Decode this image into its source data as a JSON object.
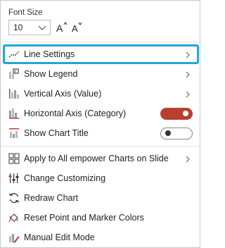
{
  "font_size": {
    "label": "Font Size",
    "value": "10",
    "increase_label": "A",
    "decrease_label": "A"
  },
  "menu": {
    "line_settings": "Line Settings",
    "show_legend": "Show Legend",
    "vertical_axis": "Vertical Axis (Value)",
    "horizontal_axis": "Horizontal Axis (Category)",
    "show_chart_title": "Show Chart Title",
    "apply_all": "Apply to All empower Charts on Slide",
    "change_customizing": "Change Customizing",
    "redraw_chart": "Redraw Chart",
    "reset_colors": "Reset Point and Marker Colors",
    "manual_edit": "Manual Edit Mode"
  },
  "toggles": {
    "horizontal_axis_on": true,
    "show_chart_title_on": false
  },
  "colors": {
    "highlight_border": "#1fa7d6",
    "toggle_on": "#b9402e"
  }
}
